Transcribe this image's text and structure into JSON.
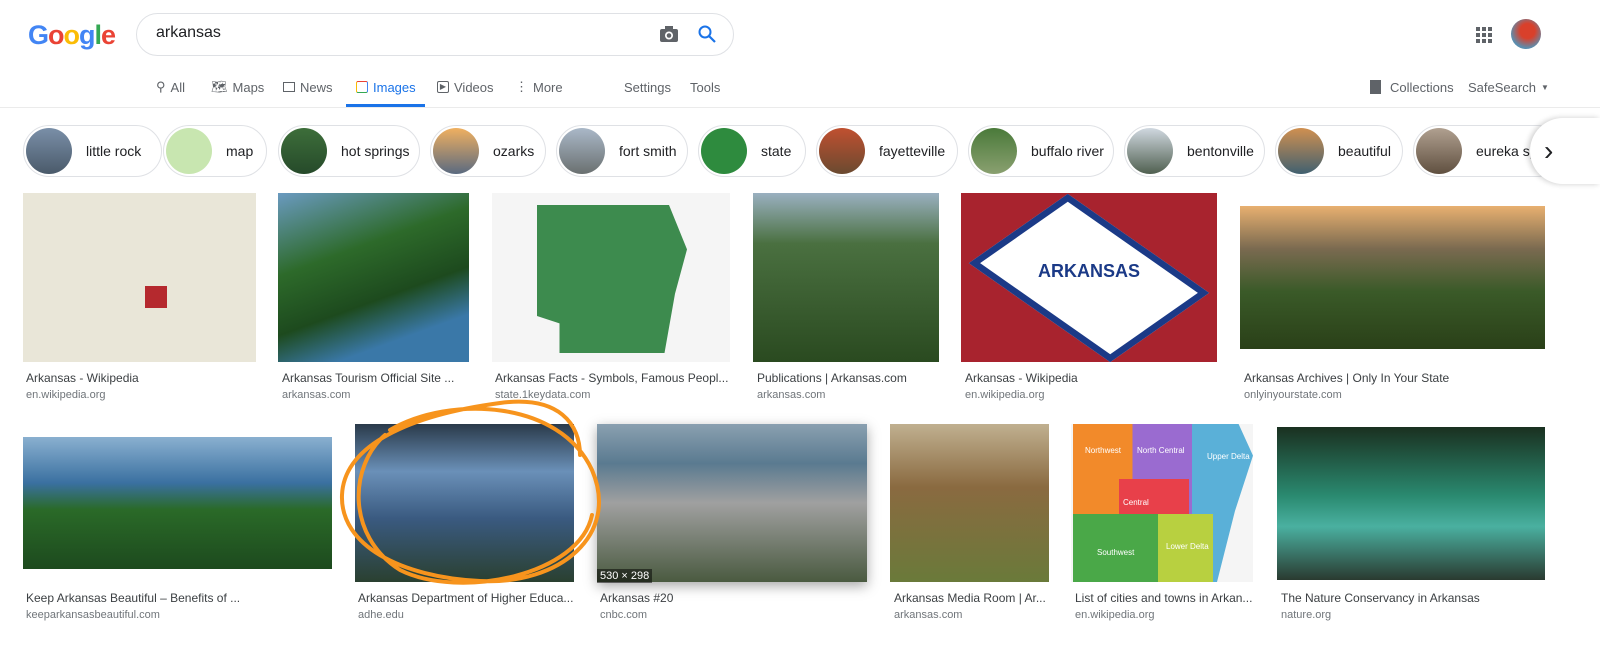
{
  "logo": "Google",
  "search": {
    "query": "arkansas"
  },
  "nav": [
    {
      "label": "All",
      "icon": "search-icon"
    },
    {
      "label": "Maps",
      "icon": "map-icon"
    },
    {
      "label": "News",
      "icon": "news-icon"
    },
    {
      "label": "Images",
      "icon": "image-icon",
      "active": true
    },
    {
      "label": "Videos",
      "icon": "play-icon"
    },
    {
      "label": "More",
      "icon": "more-vert-icon"
    }
  ],
  "settings": "Settings",
  "tools": "Tools",
  "collections": "Collections",
  "safesearch": "SafeSearch",
  "chips": [
    "little rock",
    "map",
    "hot springs",
    "ozarks",
    "fort smith",
    "state",
    "fayetteville",
    "buffalo river",
    "bentonville",
    "beautiful",
    "eureka springs"
  ],
  "results": [
    {
      "title": "Arkansas - Wikipedia",
      "domain": "en.wikipedia.org"
    },
    {
      "title": "Arkansas Tourism Official Site ...",
      "domain": "arkansas.com"
    },
    {
      "title": "Arkansas Facts - Symbols, Famous Peopl...",
      "domain": "state.1keydata.com"
    },
    {
      "title": "Publications | Arkansas.com",
      "domain": "arkansas.com"
    },
    {
      "title": "Arkansas - Wikipedia",
      "domain": "en.wikipedia.org",
      "image_text": "ARKANSAS"
    },
    {
      "title": "Arkansas Archives | Only In Your State",
      "domain": "onlyinyourstate.com"
    },
    {
      "title": "Keep Arkansas Beautiful – Benefits of ...",
      "domain": "keeparkansasbeautiful.com"
    },
    {
      "title": "Arkansas Department of Higher Educa...",
      "domain": "adhe.edu"
    },
    {
      "title": "Arkansas #20",
      "domain": "cnbc.com",
      "dimensions": "530 × 298"
    },
    {
      "title": "Arkansas Media Room | Ar...",
      "domain": "arkansas.com"
    },
    {
      "title": "List of cities and towns in Arkan...",
      "domain": "en.wikipedia.org",
      "regions": [
        "Northwest",
        "North Central",
        "Upper Delta",
        "Central",
        "Southwest",
        "Lower Delta"
      ]
    },
    {
      "title": "The Nature Conservancy in Arkansas",
      "domain": "nature.org"
    }
  ],
  "colors": {
    "accent": "#1a73e8",
    "annotation": "#f7941d"
  }
}
